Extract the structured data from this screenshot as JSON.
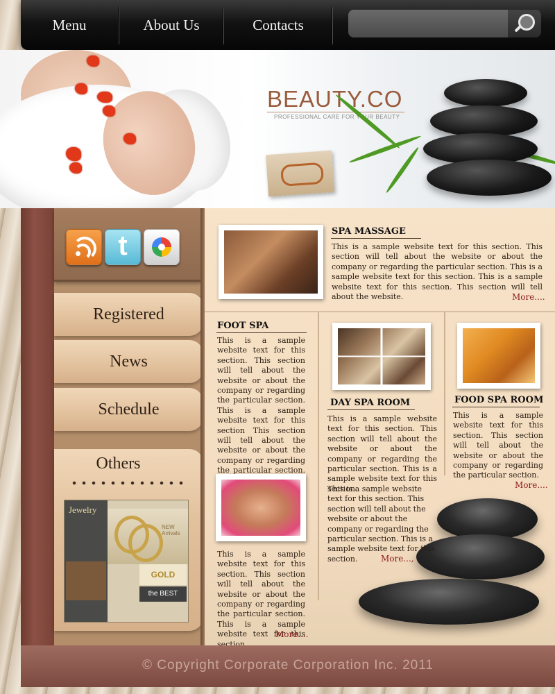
{
  "nav": {
    "items": [
      "Menu",
      "About Us",
      "Contacts"
    ],
    "search_placeholder": ""
  },
  "banner": {
    "title": "BEAUTY.CO",
    "subtitle": "PROFESSIONAL CARE FOR YOUR BEAUTY"
  },
  "sidebar": {
    "social": [
      "rss-icon",
      "twitter-icon",
      "picasa-icon"
    ],
    "twitter_glyph": "t",
    "tabs": [
      "Registered",
      "News",
      "Schedule"
    ],
    "others_title": "Others",
    "jewelry": {
      "logo": "Jewelry",
      "headline": "NEW Arrivals",
      "gold": "GOLD",
      "best": "the BEST"
    }
  },
  "sections": {
    "spa_massage": {
      "title": "SPA MASSAGE",
      "text": "This is a sample website text for this section. This section will tell about the website or about the company or regarding the particular section. This is a sample website text for this section. This is a sample website text for this section. This section will tell about the website.",
      "more": "More...."
    },
    "foot_spa": {
      "title": "FOOT SPA",
      "text": "This is a sample website text for this section. This section will tell about the website or about the company or regarding the particular section. This is a sample website text for this section This section will tell about the website or about the company or regarding the particular section. This is a sample website...",
      "text2": "This is a sample website text for this section. This section will tell about the website or about the company or regarding the particular section. This is a sample website text for this section.",
      "more": "More...."
    },
    "day_spa": {
      "title": "DAY SPA ROOM",
      "text": "This is a sample website text for this section. This section will tell about the website or about the company or regarding the particular section. This is a sample website text for this section.",
      "text2": "This is a sample website text for this section. This section will tell about the website or about the company or regarding the particular section. This is a sample website text for this section.",
      "more": "More...,"
    },
    "food_spa": {
      "title": "FOOD SPA ROOM",
      "text": "This is a sample website text for this section. This section will tell about the website or about the company or regarding the particular section.",
      "more": "More...."
    }
  },
  "footer": {
    "copyright": "© Copyright Corporate Corporation Inc. 2011"
  },
  "colors": {
    "accent": "#9a5c3c",
    "more_link": "#8b1a1a",
    "frame": "#8c5045"
  }
}
